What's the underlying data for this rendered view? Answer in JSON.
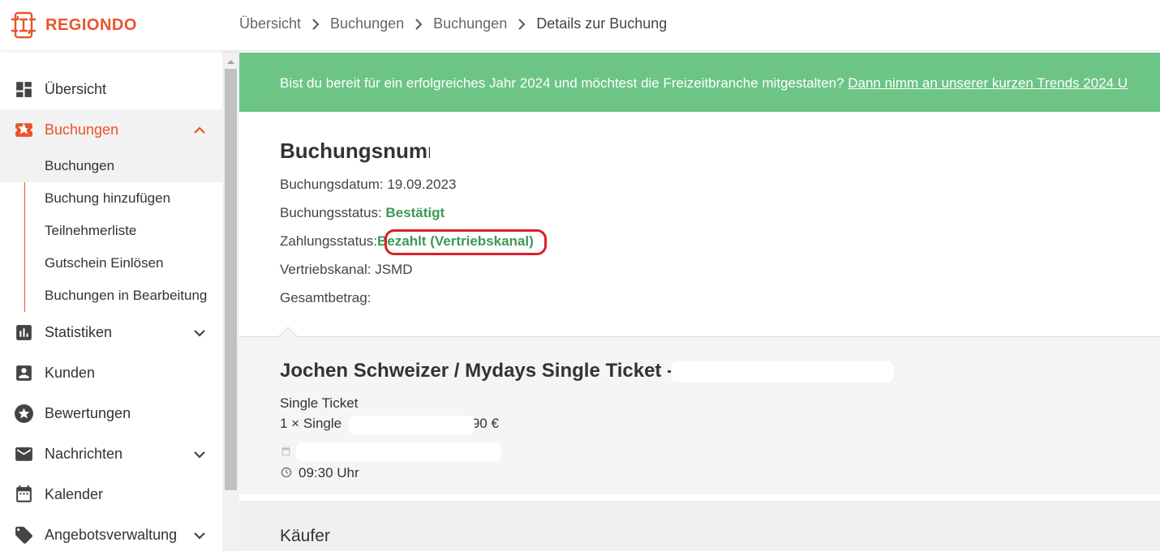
{
  "brand": {
    "name": "REGIONDO",
    "color": "#e8542b"
  },
  "breadcrumb": [
    "Übersicht",
    "Buchungen",
    "Buchungen",
    "Details zur Buchung"
  ],
  "sidebar": {
    "items": [
      {
        "label": "Übersicht",
        "icon": "dashboard-icon"
      },
      {
        "label": "Buchungen",
        "icon": "ticket-star-icon",
        "expanded": true,
        "children": [
          "Buchungen",
          "Buchung hinzufügen",
          "Teilnehmerliste",
          "Gutschein Einlösen",
          "Buchungen in Bearbeitung"
        ]
      },
      {
        "label": "Statistiken",
        "icon": "bar-chart-icon"
      },
      {
        "label": "Kunden",
        "icon": "person-card-icon"
      },
      {
        "label": "Bewertungen",
        "icon": "star-circle-icon"
      },
      {
        "label": "Nachrichten",
        "icon": "envelope-icon"
      },
      {
        "label": "Kalender",
        "icon": "calendar-icon"
      },
      {
        "label": "Angebotsverwaltung",
        "icon": "tag-icon"
      }
    ]
  },
  "banner": {
    "text": "Bist du bereit für ein erfolgreiches Jahr 2024 und möchtest die Freizeitbranche mitgestalten? ",
    "link": "Dann nimm an unserer kurzen Trends 2024 U",
    "color": "#6cc485"
  },
  "booking": {
    "title": "Buchungsnummer #",
    "date_label": "Buchungsdatum: ",
    "date_value": "19.09.2023",
    "status_label": "Buchungsstatus: ",
    "status_value": "Bestätigt",
    "payment_label": "Zahlungsstatus:",
    "payment_value": "Bezahlt (Vertriebskanal)",
    "channel_label": "Vertriebskanal: ",
    "channel_value": "JSMD",
    "total_label": "Gesamtbetrag:",
    "status_color": "#3b9a53"
  },
  "ticket": {
    "title": "Jochen Schweizer / Mydays Single Ticket -",
    "type": "Single Ticket",
    "line_prefix": "1 × Single",
    "line_suffix": ".90 €",
    "time": "09:30 Uhr"
  },
  "buyer": {
    "title": "Käufer"
  }
}
